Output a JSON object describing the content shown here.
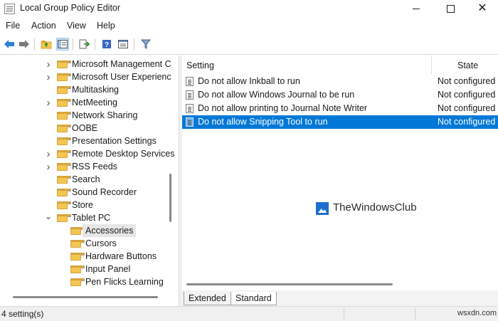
{
  "window": {
    "title": "Local Group Policy Editor"
  },
  "menu": [
    "File",
    "Action",
    "View",
    "Help"
  ],
  "toolbar": {
    "icons": [
      "back-arrow-icon",
      "forward-arrow-icon",
      "up-folder-icon",
      "show-hide-tree-icon",
      "export-list-icon",
      "help-icon",
      "properties-icon",
      "filter-icon"
    ]
  },
  "tree": {
    "items": [
      {
        "label": "Microsoft Management C",
        "expandable": true
      },
      {
        "label": "Microsoft User Experienc",
        "expandable": true
      },
      {
        "label": "Multitasking",
        "expandable": false
      },
      {
        "label": "NetMeeting",
        "expandable": true
      },
      {
        "label": "Network Sharing",
        "expandable": false
      },
      {
        "label": "OOBE",
        "expandable": false
      },
      {
        "label": "Presentation Settings",
        "expandable": false
      },
      {
        "label": "Remote Desktop Services",
        "expandable": true
      },
      {
        "label": "RSS Feeds",
        "expandable": true
      },
      {
        "label": "Search",
        "expandable": false
      },
      {
        "label": "Sound Recorder",
        "expandable": false
      },
      {
        "label": "Store",
        "expandable": false
      },
      {
        "label": "Tablet PC",
        "expanded": true
      },
      {
        "label": "Accessories",
        "selected": true,
        "child": true
      },
      {
        "label": "Cursors",
        "child": true
      },
      {
        "label": "Hardware Buttons",
        "child": true
      },
      {
        "label": "Input Panel",
        "child": true
      },
      {
        "label": "Pen Flicks Learning",
        "child": true
      }
    ]
  },
  "list": {
    "columns": {
      "setting": "Setting",
      "state": "State"
    },
    "rows": [
      {
        "name": "Do not allow Inkball to run",
        "state": "Not configured"
      },
      {
        "name": "Do not allow Windows Journal to be run",
        "state": "Not configured"
      },
      {
        "name": "Do not allow printing to Journal Note Writer",
        "state": "Not configured"
      },
      {
        "name": "Do not allow Snipping Tool to run",
        "state": "Not configured",
        "selected": true
      }
    ],
    "watermark": "TheWindowsClub"
  },
  "tabs": {
    "extended": "Extended",
    "standard": "Standard",
    "active": "Standard"
  },
  "status": {
    "count": "4 setting(s)",
    "corner_mark": "wsxdn.com"
  },
  "colors": {
    "selection": "#0078d7",
    "folder": "#f3c652"
  }
}
